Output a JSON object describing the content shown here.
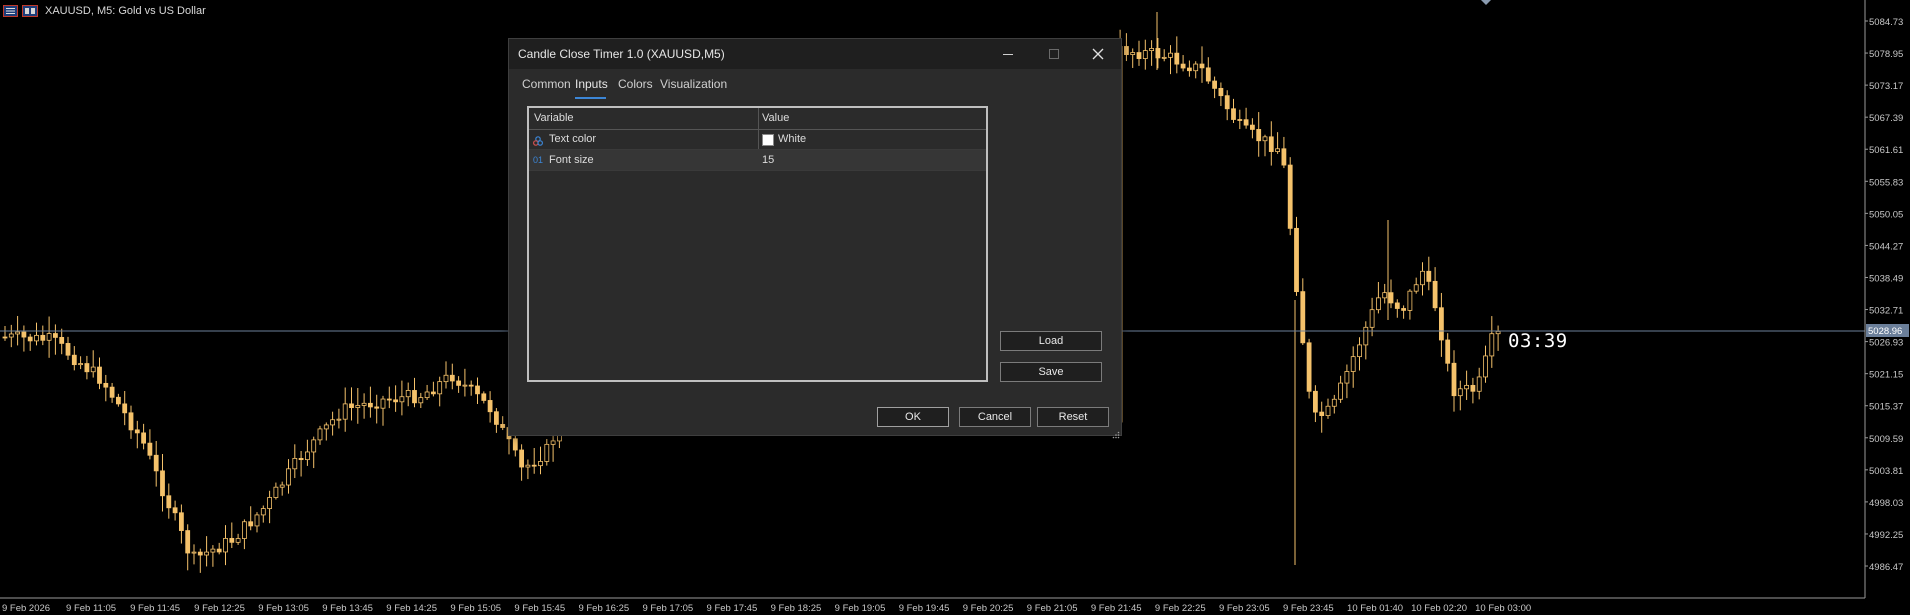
{
  "chart": {
    "symbol_title": "XAUUSD, M5:  Gold vs US Dollar",
    "current_price": "5028.96",
    "timer": "03:39",
    "price_labels": [
      "5084.73",
      "5078.95",
      "5073.17",
      "5067.39",
      "5061.61",
      "5055.83",
      "5050.05",
      "5044.27",
      "5038.49",
      "5032.71",
      "5026.93",
      "5021.15",
      "5015.37",
      "5009.59",
      "5003.81",
      "4998.03",
      "4992.25",
      "4986.47"
    ],
    "time_labels": [
      "9 Feb 2026",
      "9 Feb 11:05",
      "9 Feb 11:45",
      "9 Feb 12:25",
      "9 Feb 13:05",
      "9 Feb 13:45",
      "9 Feb 14:25",
      "9 Feb 15:05",
      "9 Feb 15:45",
      "9 Feb 16:25",
      "9 Feb 17:05",
      "9 Feb 17:45",
      "9 Feb 18:25",
      "9 Feb 19:05",
      "9 Feb 19:45",
      "9 Feb 20:25",
      "9 Feb 21:05",
      "9 Feb 21:45",
      "9 Feb 22:25",
      "9 Feb 23:05",
      "9 Feb 23:45",
      "10 Feb 01:40",
      "10 Feb 02:20",
      "10 Feb 03:00"
    ],
    "colors": {
      "candle": "#f5c26b",
      "price_line": "#6b7f9a",
      "price_tag_bg": "#6b7f9a",
      "axis_text": "#c8c8c8"
    }
  },
  "dialog": {
    "title": "Candle Close Timer 1.0 (XAUUSD,M5)",
    "tabs": [
      {
        "label": "Common",
        "active": false
      },
      {
        "label": "Inputs",
        "active": true
      },
      {
        "label": "Colors",
        "active": false
      },
      {
        "label": "Visualization",
        "active": false
      }
    ],
    "table": {
      "headers": {
        "variable": "Variable",
        "value": "Value"
      },
      "rows": [
        {
          "icon": "color-palette-icon",
          "variable": "Text color",
          "value": "White",
          "swatch": "#ffffff"
        },
        {
          "icon": "integer-icon",
          "icon_text": "01",
          "variable": "Font size",
          "value": "15"
        }
      ]
    },
    "buttons": {
      "load": "Load",
      "save": "Save",
      "ok": "OK",
      "cancel": "Cancel",
      "reset": "Reset"
    }
  }
}
